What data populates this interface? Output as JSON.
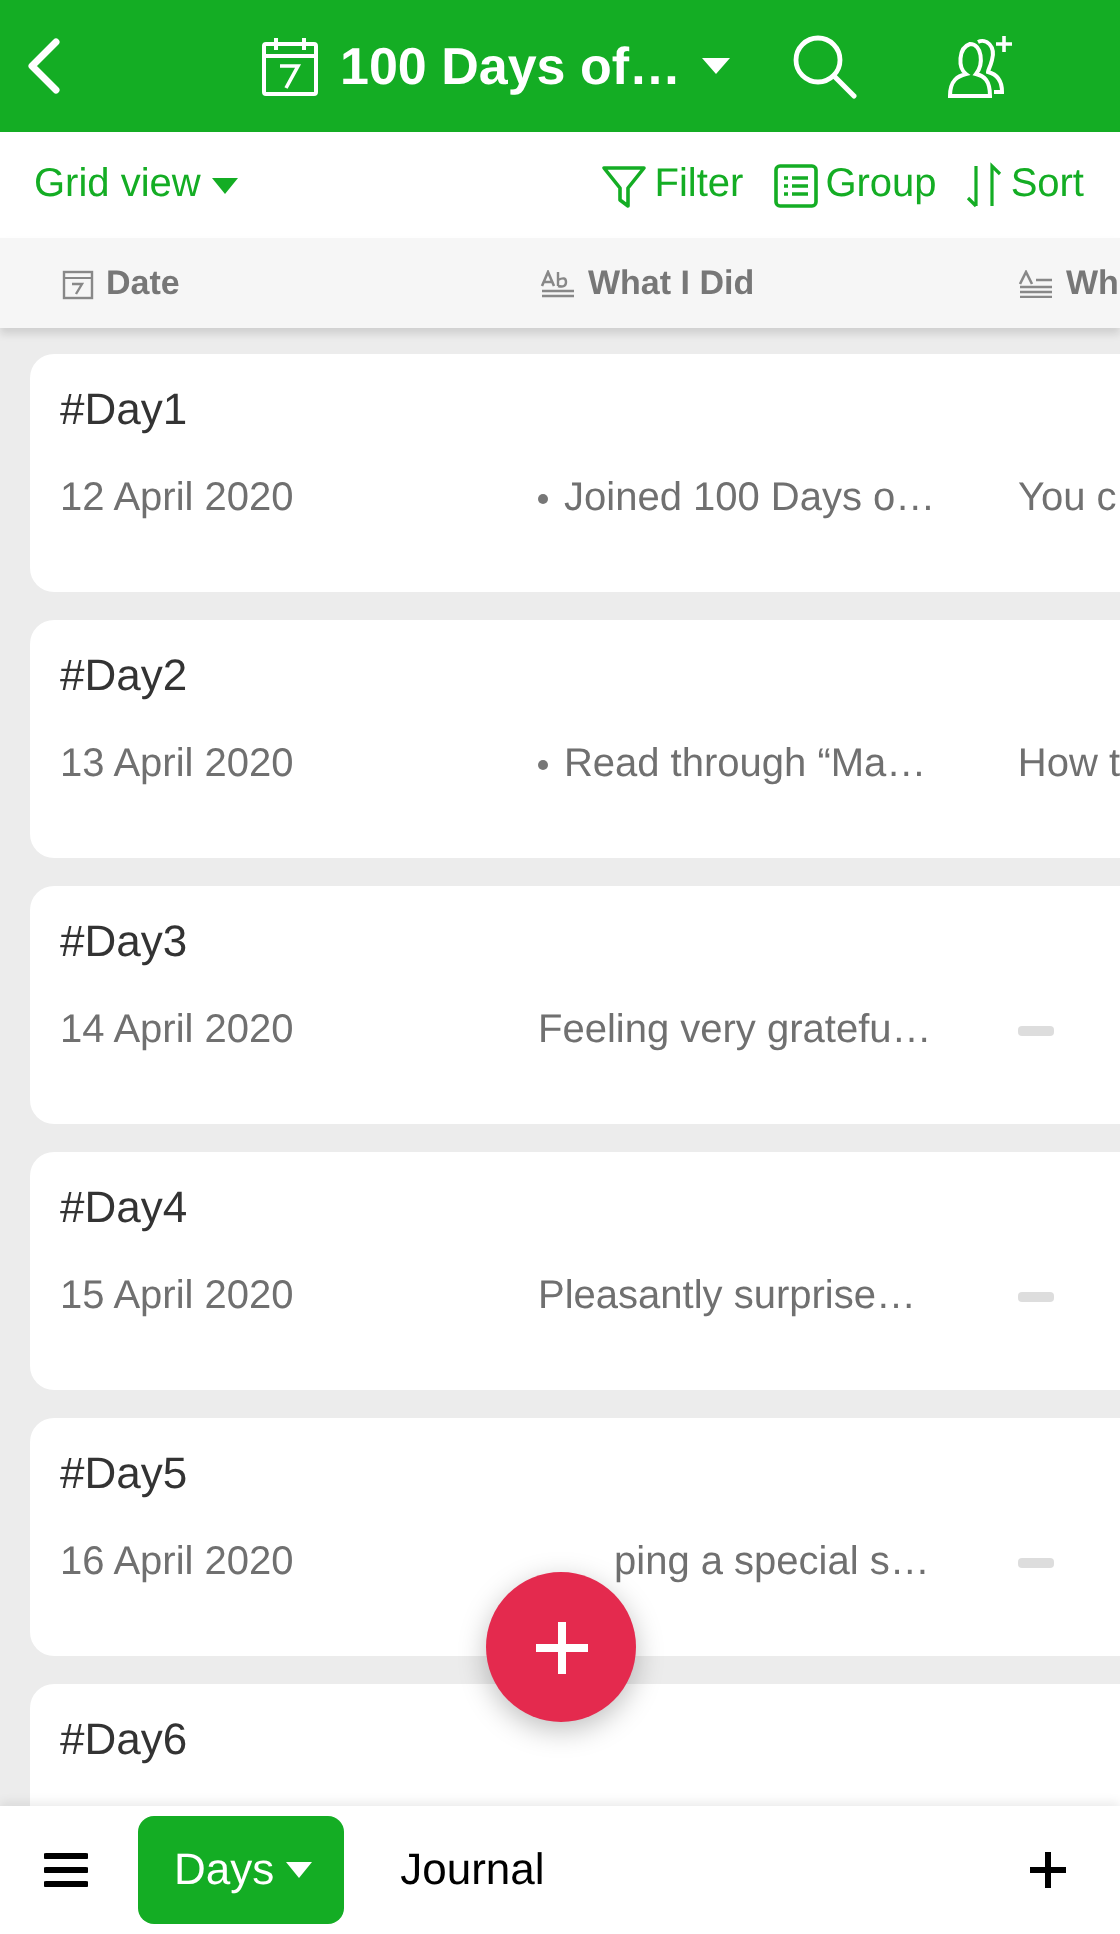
{
  "header": {
    "title": "100 Days of…"
  },
  "toolbar": {
    "view": "Grid view",
    "actions": [
      {
        "kind": "filter",
        "label": "Filter"
      },
      {
        "kind": "group",
        "label": "Group"
      },
      {
        "kind": "sort",
        "label": "Sort"
      }
    ]
  },
  "columns": [
    {
      "kind": "date",
      "label": "Date"
    },
    {
      "kind": "text",
      "label": "What I Did"
    },
    {
      "kind": "longtext",
      "label": "Wh"
    }
  ],
  "records": [
    {
      "title": "#Day1",
      "cells": [
        {
          "kind": "text",
          "text": "12 April 2020"
        },
        {
          "kind": "bullet",
          "text": "Joined 100 Days o…"
        },
        {
          "kind": "text",
          "text": "You c"
        }
      ]
    },
    {
      "title": "#Day2",
      "cells": [
        {
          "kind": "text",
          "text": "13 April 2020"
        },
        {
          "kind": "bullet",
          "text": "Read through “Ma…"
        },
        {
          "kind": "text",
          "text": "How t"
        }
      ]
    },
    {
      "title": "#Day3",
      "cells": [
        {
          "kind": "text",
          "text": "14 April 2020"
        },
        {
          "kind": "text",
          "text": "Feeling very gratefu…"
        },
        {
          "kind": "empty"
        }
      ]
    },
    {
      "title": "#Day4",
      "cells": [
        {
          "kind": "text",
          "text": "15 April 2020"
        },
        {
          "kind": "text",
          "text": "Pleasantly surprise…"
        },
        {
          "kind": "empty"
        }
      ]
    },
    {
      "title": "#Day5",
      "cells": [
        {
          "kind": "text",
          "text": "16 April 2020"
        },
        {
          "kind": "covered",
          "text": "ping a special s…"
        },
        {
          "kind": "empty"
        }
      ]
    },
    {
      "title": "#Day6"
    }
  ],
  "bottom_tabs": [
    {
      "label": "Days",
      "selected": true
    },
    {
      "label": "Journal",
      "selected": false
    }
  ]
}
